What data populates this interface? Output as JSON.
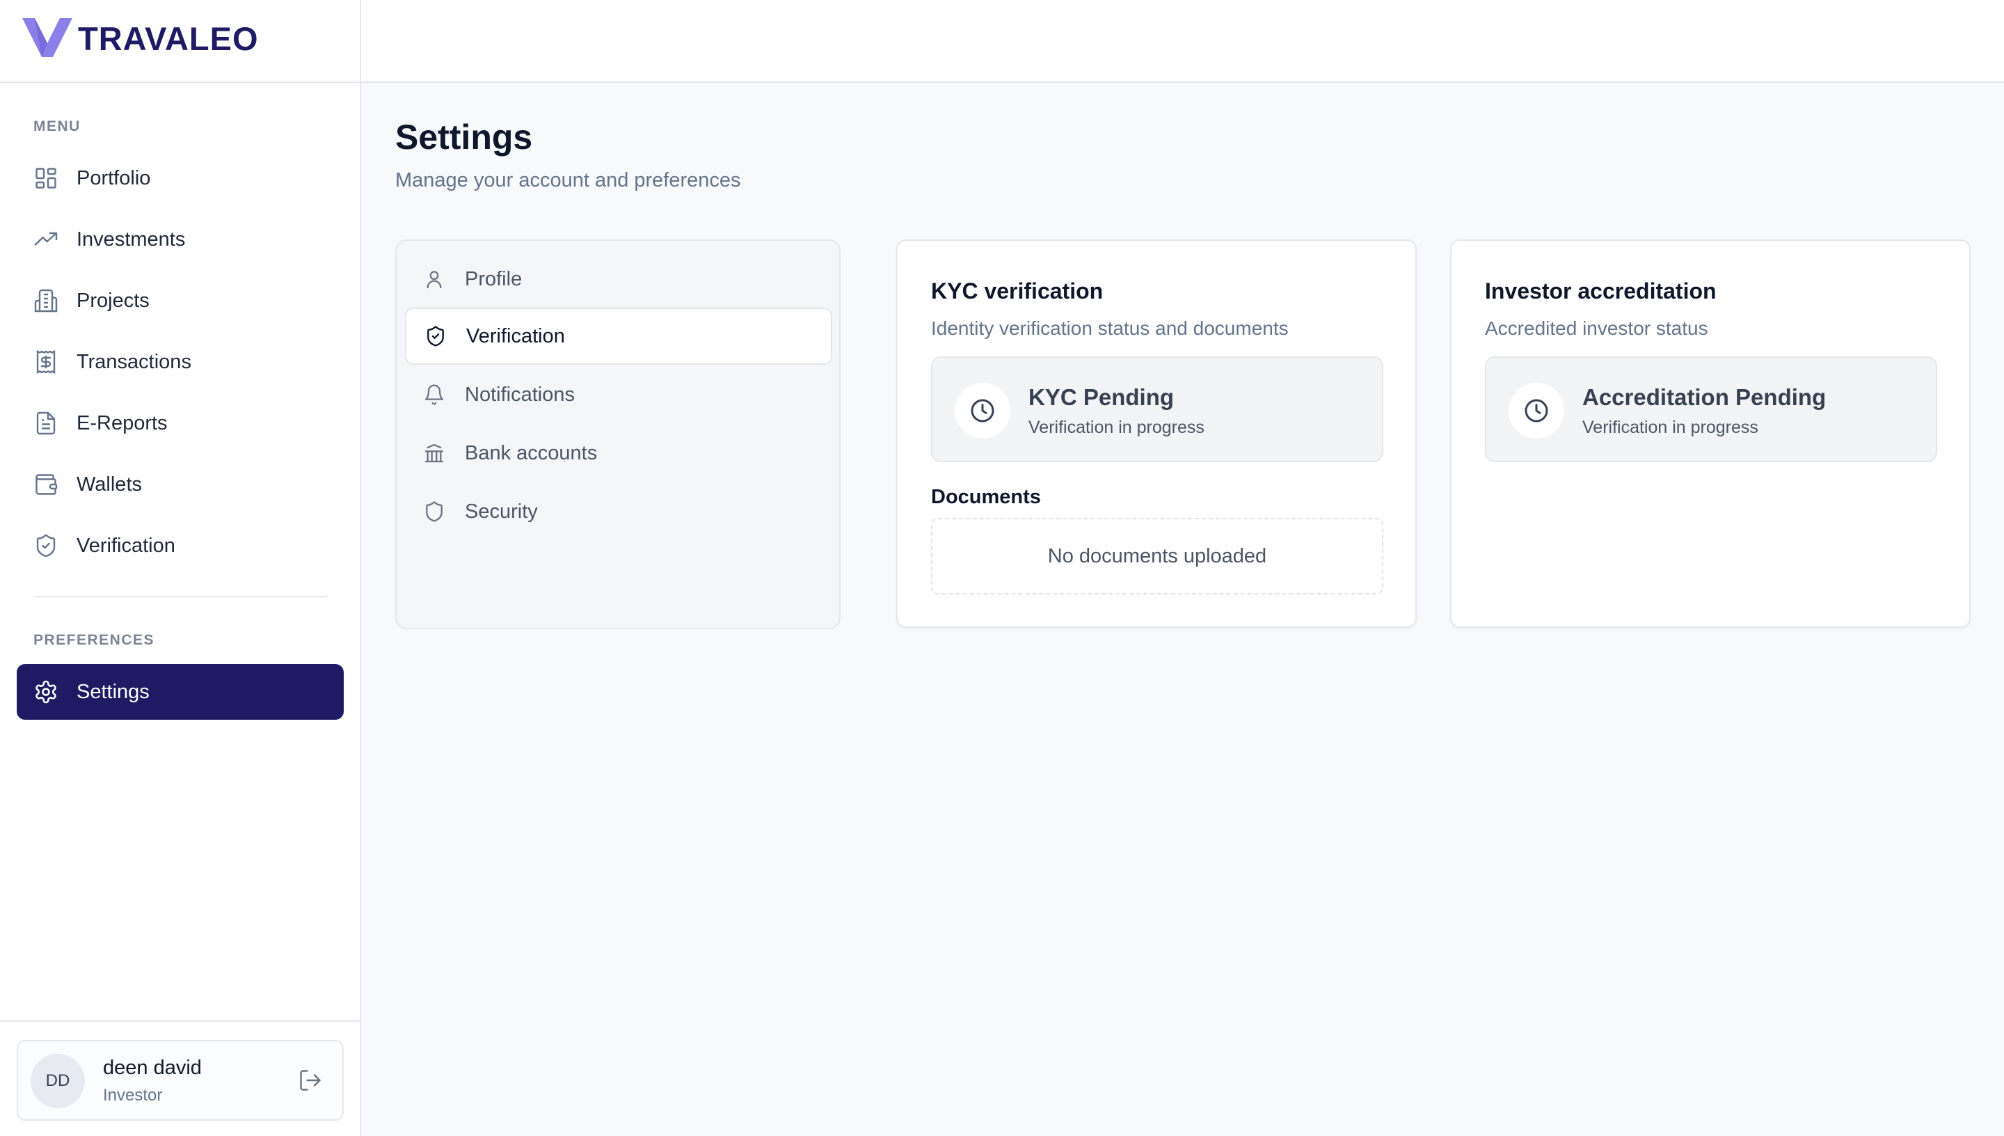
{
  "brand": {
    "name": "TRAVALEO",
    "primary_color": "#1e1b64",
    "logo_color": "#8b7fe8"
  },
  "sidebar": {
    "menu_label": "MENU",
    "items": [
      {
        "label": "Portfolio",
        "icon": "grid-icon"
      },
      {
        "label": "Investments",
        "icon": "trending-up-icon"
      },
      {
        "label": "Projects",
        "icon": "building-icon"
      },
      {
        "label": "Transactions",
        "icon": "receipt-dollar-icon"
      },
      {
        "label": "E-Reports",
        "icon": "document-icon"
      },
      {
        "label": "Wallets",
        "icon": "wallet-icon"
      },
      {
        "label": "Verification",
        "icon": "shield-check-icon"
      }
    ],
    "preferences_label": "PREFERENCES",
    "preferences_items": [
      {
        "label": "Settings",
        "icon": "gear-icon",
        "active": true
      }
    ]
  },
  "user": {
    "initials": "DD",
    "name": "deen david",
    "role": "Investor",
    "logout_icon": "logout-icon"
  },
  "page": {
    "title": "Settings",
    "subtitle": "Manage your account and preferences"
  },
  "settings_nav": [
    {
      "label": "Profile",
      "icon": "user-icon"
    },
    {
      "label": "Verification",
      "icon": "shield-check-icon",
      "active": true
    },
    {
      "label": "Notifications",
      "icon": "bell-icon"
    },
    {
      "label": "Bank accounts",
      "icon": "bank-icon"
    },
    {
      "label": "Security",
      "icon": "shield-icon"
    }
  ],
  "kyc_card": {
    "title": "KYC verification",
    "description": "Identity verification status and documents",
    "status_title": "KYC Pending",
    "status_sub": "Verification in progress",
    "status_icon": "clock-icon",
    "documents_label": "Documents",
    "documents_empty": "No documents uploaded"
  },
  "accreditation_card": {
    "title": "Investor accreditation",
    "description": "Accredited investor status",
    "status_title": "Accreditation Pending",
    "status_sub": "Verification in progress",
    "status_icon": "clock-icon"
  }
}
